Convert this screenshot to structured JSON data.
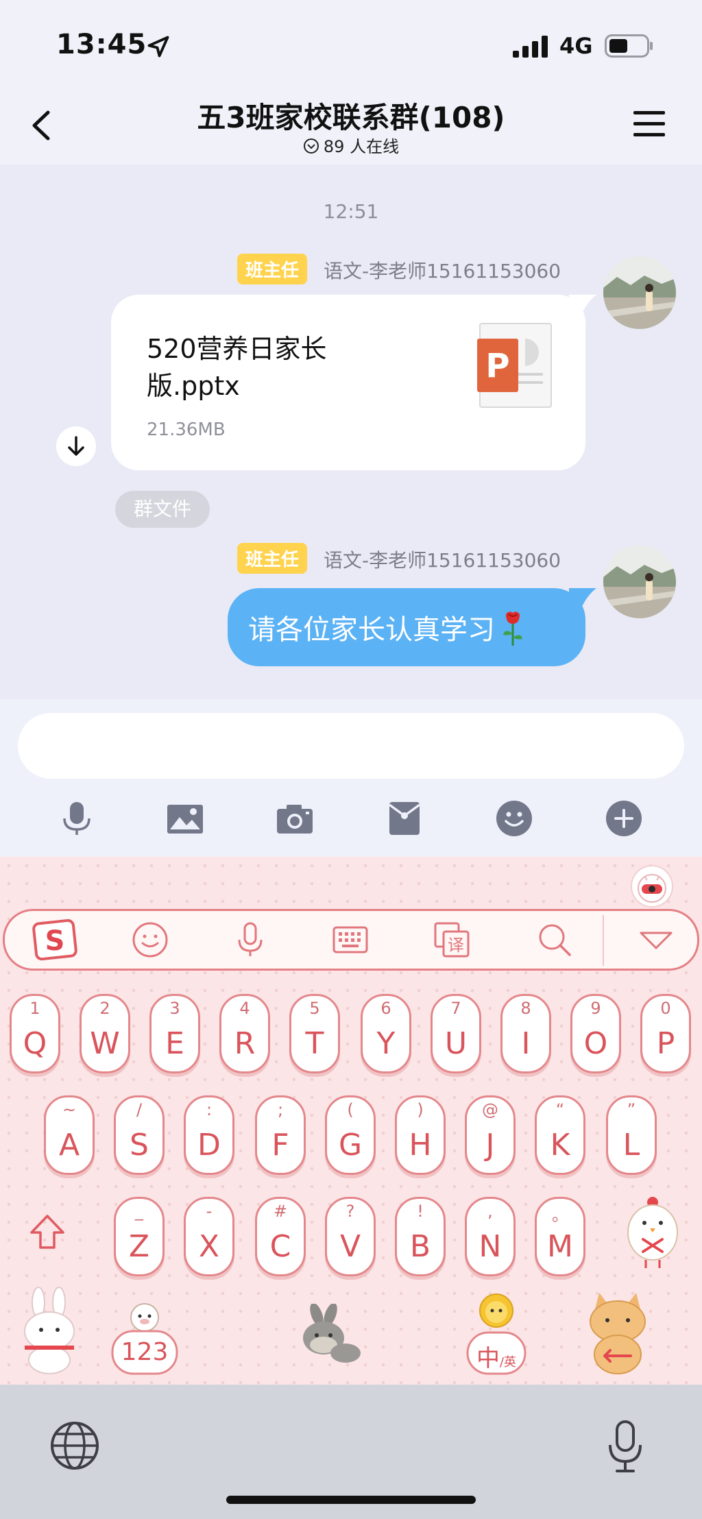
{
  "status_bar": {
    "time": "13:45",
    "network": "4G"
  },
  "header": {
    "title": "五3班家校联系群(108)",
    "online": "89 人在线"
  },
  "chat": {
    "timestamp": "12:51",
    "messages": [
      {
        "badge": "班主任",
        "sender": "语文-李老师15161153060",
        "type": "file",
        "file_name": "520营养日家长版.pptx",
        "file_size": "21.36MB",
        "file_icon": "powerpoint-icon",
        "file_icon_letter": "P",
        "tag": "群文件"
      },
      {
        "badge": "班主任",
        "sender": "语文-李老师15161153060",
        "type": "text",
        "text": "请各位家长认真学习",
        "emoji": "rose-icon"
      }
    ]
  },
  "toolbar": {
    "icons": [
      "microphone-icon",
      "image-icon",
      "camera-icon",
      "red-packet-icon",
      "emoji-icon",
      "plus-icon"
    ]
  },
  "keyboard": {
    "toolbar_icons": [
      "sogou-logo-icon",
      "emoji-icon",
      "microphone-icon",
      "keyboard-icon",
      "translate-icon",
      "search-icon",
      "collapse-icon"
    ],
    "logo_letter": "S",
    "translate_label": "译",
    "rows": [
      [
        {
          "alt": "1",
          "char": "Q"
        },
        {
          "alt": "2",
          "char": "W"
        },
        {
          "alt": "3",
          "char": "E"
        },
        {
          "alt": "4",
          "char": "R"
        },
        {
          "alt": "5",
          "char": "T"
        },
        {
          "alt": "6",
          "char": "Y"
        },
        {
          "alt": "7",
          "char": "U"
        },
        {
          "alt": "8",
          "char": "I"
        },
        {
          "alt": "9",
          "char": "O"
        },
        {
          "alt": "0",
          "char": "P"
        }
      ],
      [
        {
          "alt": "~",
          "char": "A"
        },
        {
          "alt": "/",
          "char": "S"
        },
        {
          "alt": ":",
          "char": "D"
        },
        {
          "alt": ";",
          "char": "F"
        },
        {
          "alt": "(",
          "char": "G"
        },
        {
          "alt": ")",
          "char": "H"
        },
        {
          "alt": "@",
          "char": "J"
        },
        {
          "alt": "“",
          "char": "K"
        },
        {
          "alt": "”",
          "char": "L"
        }
      ],
      [
        {
          "alt": "_",
          "char": "Z"
        },
        {
          "alt": "-",
          "char": "X"
        },
        {
          "alt": "#",
          "char": "C"
        },
        {
          "alt": "?",
          "char": "V"
        },
        {
          "alt": "!",
          "char": "B"
        },
        {
          "alt": ",",
          "char": "N"
        },
        {
          "alt": "。",
          "char": "M"
        }
      ]
    ],
    "number_key": "123",
    "lang_key": {
      "main": "中",
      "sub": "/英"
    }
  }
}
